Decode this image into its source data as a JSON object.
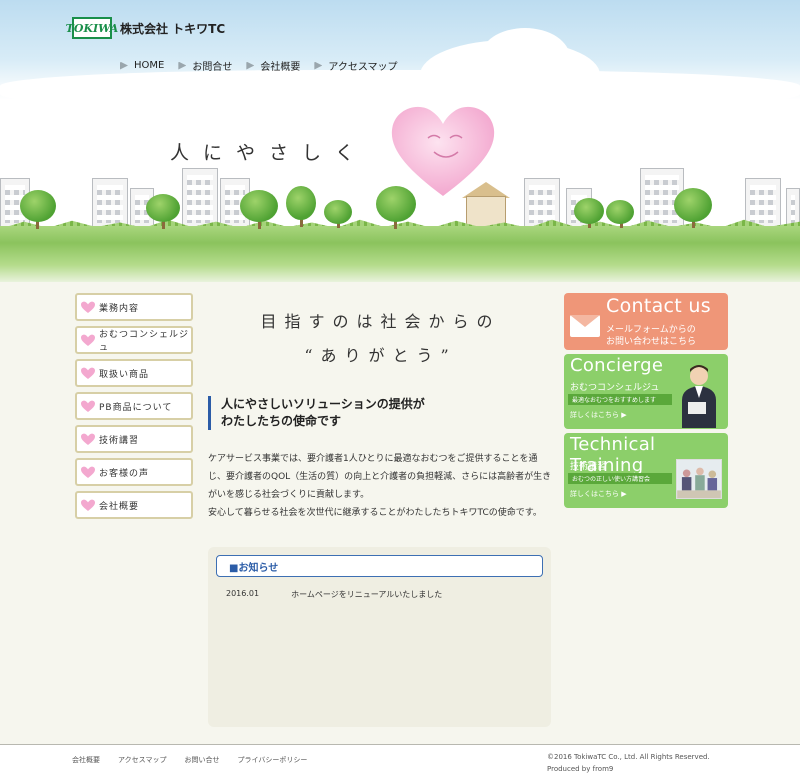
{
  "header": {
    "logo_mark": "TOKIWA",
    "company_name": "株式会社 トキワTC",
    "nav": [
      {
        "label": "HOME"
      },
      {
        "label": "お問合せ"
      },
      {
        "label": "会社概要"
      },
      {
        "label": "アクセスマップ"
      }
    ],
    "catch_copy": "人にやさしく"
  },
  "sidebar": {
    "items": [
      {
        "label": "業務内容"
      },
      {
        "label": "おむつコンシェルジュ"
      },
      {
        "label": "取扱い商品"
      },
      {
        "label": "PB商品について"
      },
      {
        "label": "技術講習"
      },
      {
        "label": "お客様の声"
      },
      {
        "label": "会社概要"
      }
    ]
  },
  "main": {
    "lead_line1": "目指すのは社会からの",
    "lead_line2": "“ありがとう”",
    "subhead_line1": "人にやさしいソリューションの提供が",
    "subhead_line2": "わたしたちの使命です",
    "paragraph1": "ケアサービス事業では、要介護者1人ひとりに最適なおむつをご提供することを通じ、要介護者のQOL（生活の質）の向上と介護者の負担軽減、さらには高齢者が生きがいを感じる社会づくりに貢献します。",
    "paragraph2": "安心して暮らせる社会を次世代に継承することがわたしたちトキワTCの使命です。"
  },
  "news": {
    "heading": "■お知らせ",
    "items": [
      {
        "date": "2016.01",
        "text": "ホームページをリニューアルいたしました"
      }
    ]
  },
  "banners": {
    "contact": {
      "title": "Contact us",
      "line1": "メールフォームからの",
      "line2": "お問い合わせはこちら"
    },
    "concierge": {
      "title": "Concierge",
      "sub": "おむつコンシェルジュ",
      "strip": "最適なおむつをおすすめします",
      "more": "詳しくはこちら ▶"
    },
    "technical": {
      "title": "Technical Training",
      "sub": "技術講習",
      "strip": "おむつの正しい使い方講習会",
      "more": "詳しくはこちら ▶"
    }
  },
  "footer": {
    "nav": [
      {
        "label": "会社概要"
      },
      {
        "label": "アクセスマップ"
      },
      {
        "label": "お問い合せ"
      },
      {
        "label": "プライバシーポリシー"
      }
    ],
    "copyright": "©2016 TokiwaTC Co., Ltd. All Rights Reserved.",
    "produced": "Produced by from9"
  },
  "colors": {
    "accent_blue": "#2b5ca7",
    "contact_orange": "#ef9678",
    "banner_green": "#8ccf6a",
    "heart_pink": "#f3a8cf"
  }
}
